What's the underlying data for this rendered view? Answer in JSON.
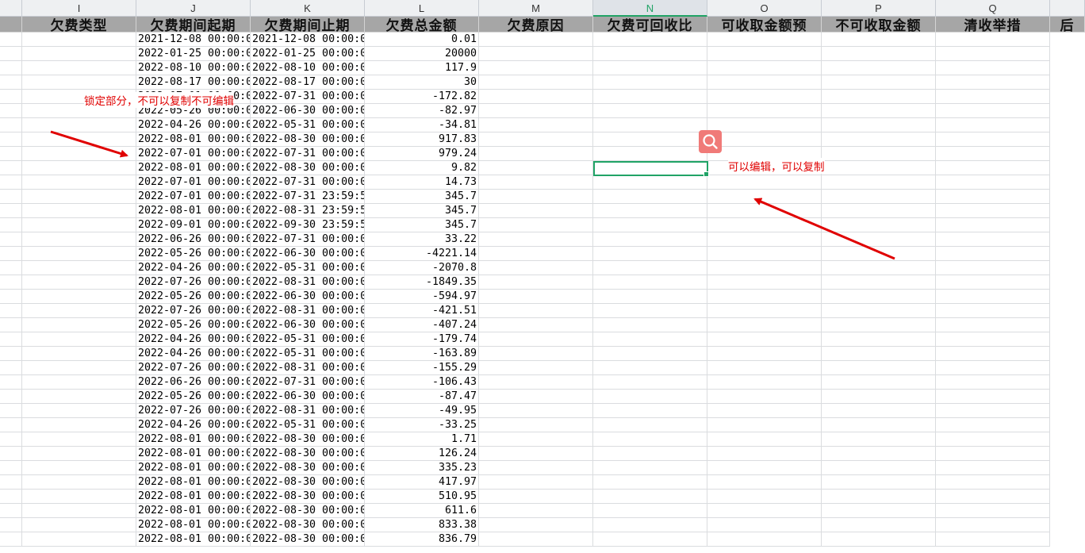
{
  "columns": [
    {
      "letter": "I",
      "title": "欠费类型"
    },
    {
      "letter": "J",
      "title": "欠费期间起期"
    },
    {
      "letter": "K",
      "title": "欠费期间止期"
    },
    {
      "letter": "L",
      "title": "欠费总金额"
    },
    {
      "letter": "M",
      "title": "欠费原因"
    },
    {
      "letter": "N",
      "title": "欠费可回收比"
    },
    {
      "letter": "O",
      "title": "可收取金额预"
    },
    {
      "letter": "P",
      "title": "不可收取金额"
    },
    {
      "letter": "Q",
      "title": "清收举措"
    },
    {
      "letter": "",
      "title": "后"
    }
  ],
  "selected_column": "N",
  "rows": [
    {
      "start": "2021-12-08 00:00:0",
      "end": "2021-12-08 00:00:0",
      "amount": "0.01"
    },
    {
      "start": "2022-01-25 00:00:0",
      "end": "2022-01-25 00:00:0",
      "amount": "20000"
    },
    {
      "start": "2022-08-10 00:00:0",
      "end": "2022-08-10 00:00:0",
      "amount": "117.9"
    },
    {
      "start": "2022-08-17 00:00:0",
      "end": "2022-08-17 00:00:0",
      "amount": "30"
    },
    {
      "start": "2022-07-01 00:00:0",
      "end": "2022-07-31 00:00:0",
      "amount": "-172.82"
    },
    {
      "start": "2022-05-26 00:00:0",
      "end": "2022-06-30 00:00:0",
      "amount": "-82.97"
    },
    {
      "start": "2022-04-26 00:00:0",
      "end": "2022-05-31 00:00:0",
      "amount": "-34.81"
    },
    {
      "start": "2022-08-01 00:00:0",
      "end": "2022-08-30 00:00:0",
      "amount": "917.83"
    },
    {
      "start": "2022-07-01 00:00:0",
      "end": "2022-07-31 00:00:0",
      "amount": "979.24"
    },
    {
      "start": "2022-08-01 00:00:0",
      "end": "2022-08-30 00:00:0",
      "amount": "9.82"
    },
    {
      "start": "2022-07-01 00:00:0",
      "end": "2022-07-31 00:00:0",
      "amount": "14.73"
    },
    {
      "start": "2022-07-01 00:00:0",
      "end": "2022-07-31 23:59:5",
      "amount": "345.7"
    },
    {
      "start": "2022-08-01 00:00:0",
      "end": "2022-08-31 23:59:5",
      "amount": "345.7"
    },
    {
      "start": "2022-09-01 00:00:0",
      "end": "2022-09-30 23:59:5",
      "amount": "345.7"
    },
    {
      "start": "2022-06-26 00:00:0",
      "end": "2022-07-31 00:00:0",
      "amount": "33.22"
    },
    {
      "start": "2022-05-26 00:00:0",
      "end": "2022-06-30 00:00:0",
      "amount": "-4221.14"
    },
    {
      "start": "2022-04-26 00:00:0",
      "end": "2022-05-31 00:00:0",
      "amount": "-2070.8"
    },
    {
      "start": "2022-07-26 00:00:0",
      "end": "2022-08-31 00:00:0",
      "amount": "-1849.35"
    },
    {
      "start": "2022-05-26 00:00:0",
      "end": "2022-06-30 00:00:0",
      "amount": "-594.97"
    },
    {
      "start": "2022-07-26 00:00:0",
      "end": "2022-08-31 00:00:0",
      "amount": "-421.51"
    },
    {
      "start": "2022-05-26 00:00:0",
      "end": "2022-06-30 00:00:0",
      "amount": "-407.24"
    },
    {
      "start": "2022-04-26 00:00:0",
      "end": "2022-05-31 00:00:0",
      "amount": "-179.74"
    },
    {
      "start": "2022-04-26 00:00:0",
      "end": "2022-05-31 00:00:0",
      "amount": "-163.89"
    },
    {
      "start": "2022-07-26 00:00:0",
      "end": "2022-08-31 00:00:0",
      "amount": "-155.29"
    },
    {
      "start": "2022-06-26 00:00:0",
      "end": "2022-07-31 00:00:0",
      "amount": "-106.43"
    },
    {
      "start": "2022-05-26 00:00:0",
      "end": "2022-06-30 00:00:0",
      "amount": "-87.47"
    },
    {
      "start": "2022-07-26 00:00:0",
      "end": "2022-08-31 00:00:0",
      "amount": "-49.95"
    },
    {
      "start": "2022-04-26 00:00:0",
      "end": "2022-05-31 00:00:0",
      "amount": "-33.25"
    },
    {
      "start": "2022-08-01 00:00:0",
      "end": "2022-08-30 00:00:0",
      "amount": "1.71"
    },
    {
      "start": "2022-08-01 00:00:0",
      "end": "2022-08-30 00:00:0",
      "amount": "126.24"
    },
    {
      "start": "2022-08-01 00:00:0",
      "end": "2022-08-30 00:00:0",
      "amount": "335.23"
    },
    {
      "start": "2022-08-01 00:00:0",
      "end": "2022-08-30 00:00:0",
      "amount": "417.97"
    },
    {
      "start": "2022-08-01 00:00:0",
      "end": "2022-08-30 00:00:0",
      "amount": "510.95"
    },
    {
      "start": "2022-08-01 00:00:0",
      "end": "2022-08-30 00:00:0",
      "amount": "611.6"
    },
    {
      "start": "2022-08-01 00:00:0",
      "end": "2022-08-30 00:00:0",
      "amount": "833.38"
    },
    {
      "start": "2022-08-01 00:00:0",
      "end": "2022-08-30 00:00:0",
      "amount": "836.79"
    }
  ],
  "annotations": {
    "locked": "锁定部分，不可以复制不可编辑",
    "editable": "可以编辑，可以复制"
  },
  "icons": {
    "search": "search-icon"
  },
  "colors": {
    "annotation_red": "#e00000",
    "accent_green": "#21a366",
    "search_button": "#f07a78"
  }
}
